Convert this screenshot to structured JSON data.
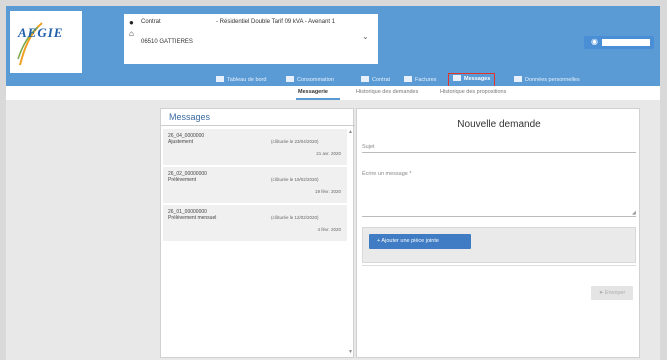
{
  "brand": {
    "name": "AEGIE"
  },
  "contract": {
    "label": "Contrat",
    "value": "- Résidentiel Double Tarif 09 kVA - Avenant 1",
    "address": "06510 GATTIERES"
  },
  "nav": {
    "items": [
      {
        "label": "Tableau de bord",
        "icon": "dashboard-icon"
      },
      {
        "label": "Consommation",
        "icon": "consumption-icon"
      },
      {
        "label": "Contrat",
        "icon": "contract-icon"
      },
      {
        "label": "Factures",
        "icon": "euro-icon"
      },
      {
        "label": "Messages",
        "icon": "message-icon",
        "active": true
      },
      {
        "label": "Données personnelles",
        "icon": "person-icon"
      }
    ]
  },
  "subtabs": [
    {
      "label": "Messagerie",
      "active": true
    },
    {
      "label": "Historique des demandes"
    },
    {
      "label": "Historique des propositions"
    }
  ],
  "messages": {
    "title": "Messages",
    "items": [
      {
        "ref": "26_04_0000000",
        "type": "Ajustement",
        "cloture": "(clôturée le 23/04/2020)",
        "date": "21 avr. 2020"
      },
      {
        "ref": "26_02_00000000",
        "type": "Prélèvement",
        "cloture": "(clôturée le 19/02/2020)",
        "date": "19 févr. 2020"
      },
      {
        "ref": "26_01_00000000",
        "type": "Prélèvement mensuel",
        "cloture": "(clôturée le 12/02/2020)",
        "date": "4 févr. 2020"
      }
    ]
  },
  "demande": {
    "title": "Nouvelle demande",
    "sujet_placeholder": "Sujet",
    "message_placeholder": "Écrire un message *",
    "attach_label": "+ Ajouter une pièce jointe",
    "send_label": "Envoyer"
  },
  "colors": {
    "header": "#5b9bd5",
    "active_outline": "#e0352b",
    "primary_button": "#3f7cc4"
  }
}
